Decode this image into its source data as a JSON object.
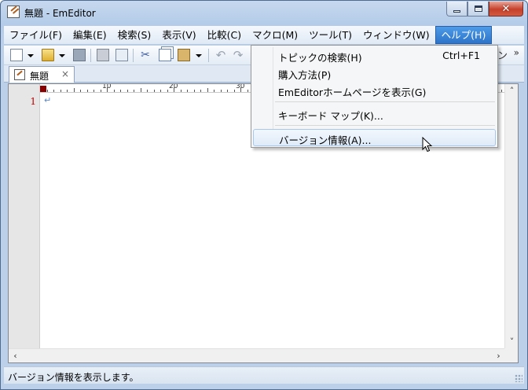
{
  "window": {
    "title": "無題 - EmEditor"
  },
  "menubar": {
    "items": [
      "ファイル(F)",
      "編集(E)",
      "検索(S)",
      "表示(V)",
      "比較(C)",
      "マクロ(M)",
      "ツール(T)",
      "ウィンドウ(W)",
      "ヘルプ(H)"
    ],
    "active_index": 8
  },
  "toolbar": {
    "buttons": [
      "new-file-icon",
      "open-folder-icon",
      "save-icon",
      "print-icon",
      "print-preview-icon",
      "cut-icon",
      "copy-icon",
      "paste-icon",
      "undo-icon",
      "redo-icon"
    ],
    "overflow": "»"
  },
  "tabs": [
    {
      "label": "無題",
      "close": "×"
    }
  ],
  "editor": {
    "line_numbers": [
      "1"
    ],
    "ruler_labels": [
      "10",
      "20",
      "30"
    ],
    "eol_mark": "↵"
  },
  "help_menu": {
    "items": [
      {
        "label": "トピックの検索(H)",
        "shortcut": "Ctrl+F1"
      },
      {
        "label": "購入方法(P)",
        "shortcut": ""
      },
      {
        "label": "EmEditorホームページを表示(G)",
        "shortcut": ""
      },
      {
        "label": "キーボード マップ(K)...",
        "shortcut": ""
      },
      {
        "label": "バージョン情報(A)...",
        "shortcut": ""
      }
    ],
    "hovered_index": 4
  },
  "statusbar": {
    "text": "バージョン情報を表示します。"
  },
  "colors": {
    "accent": "#2d74c9",
    "line_number": "#c00000"
  }
}
